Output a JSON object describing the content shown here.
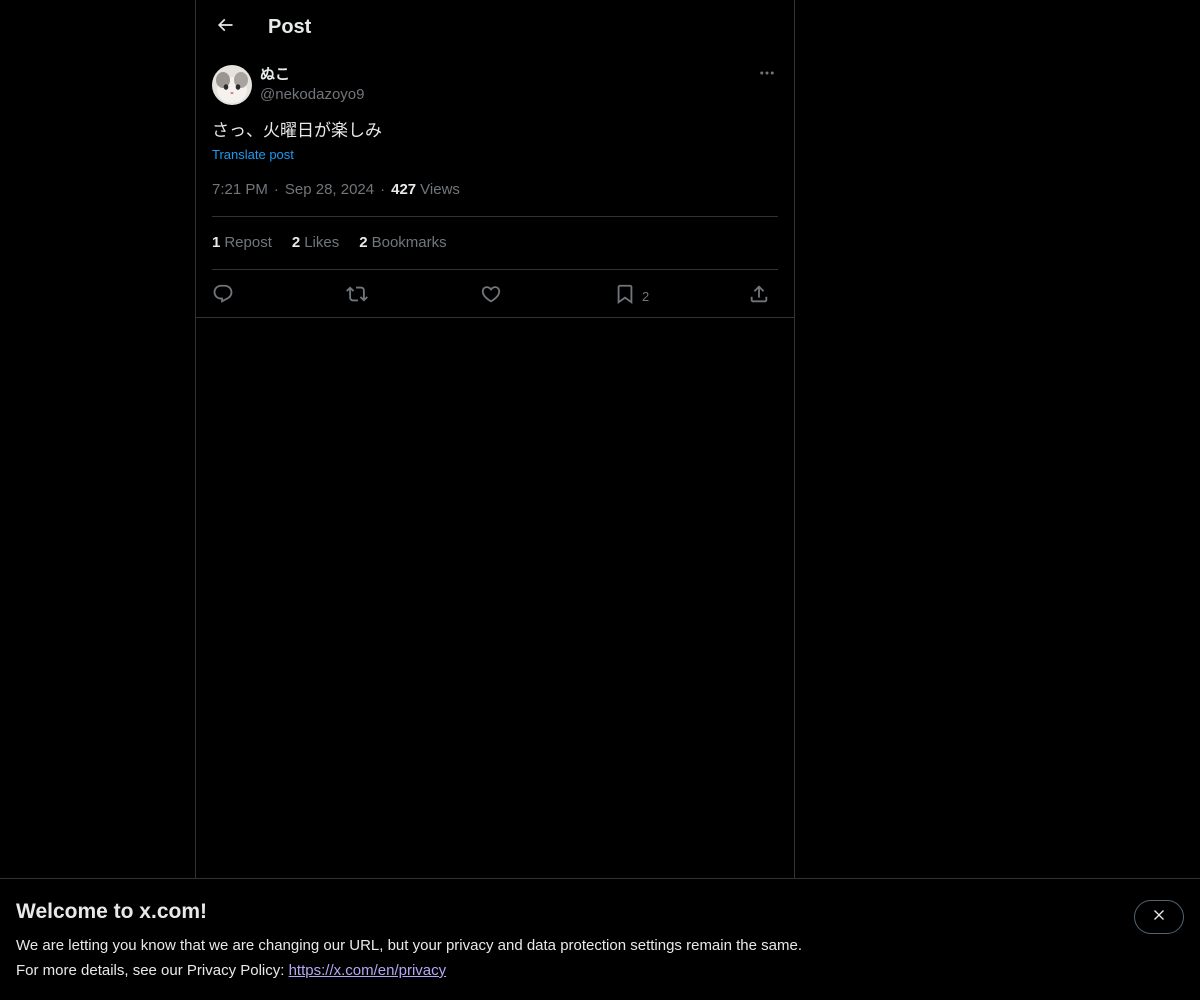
{
  "header": {
    "title": "Post"
  },
  "post": {
    "author": {
      "display_name": "ぬこ",
      "handle": "@nekodazoyo9"
    },
    "text": "さっ、火曜日が楽しみ",
    "translate_label": "Translate post",
    "time": "7:21 PM",
    "date": "Sep 28, 2024",
    "separator": "·",
    "views_count": "427",
    "views_label": "Views",
    "stats": {
      "reposts_count": "1",
      "reposts_label": "Repost",
      "likes_count": "2",
      "likes_label": "Likes",
      "bookmarks_count": "2",
      "bookmarks_label": "Bookmarks"
    },
    "actions": {
      "reply_icon": "reply-icon",
      "repost_icon": "repost-icon",
      "like_icon": "heart-icon",
      "bookmark_icon": "bookmark-icon",
      "bookmark_count": "2",
      "share_icon": "share-icon"
    }
  },
  "banner": {
    "title": "Welcome to x.com!",
    "line1": "We are letting you know that we are changing our URL, but your privacy and data protection settings remain the same.",
    "line2_prefix": "For more details, see our Privacy Policy: ",
    "link_text": "https://x.com/en/privacy"
  },
  "colors": {
    "background": "#000000",
    "text_primary": "#e7e9ea",
    "text_secondary": "#71767b",
    "accent": "#1d9bf0",
    "link": "#b4a7f5",
    "border": "#2f3336"
  }
}
